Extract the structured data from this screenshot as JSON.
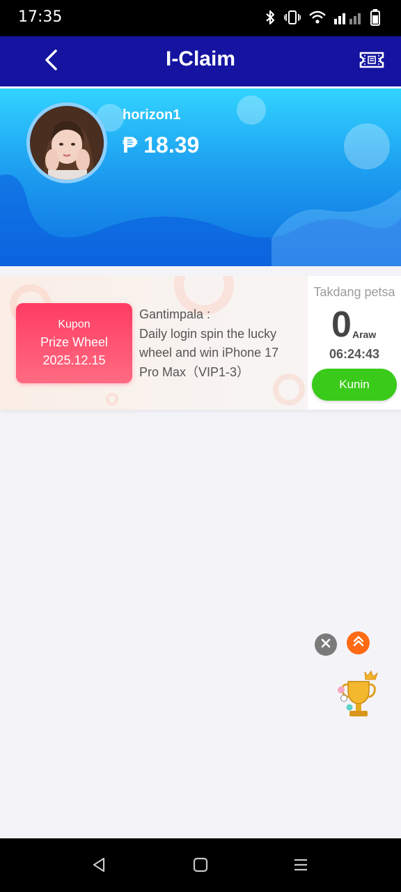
{
  "status_bar": {
    "time": "17:35",
    "icons": [
      "bluetooth-icon",
      "vibrate-icon",
      "wifi-icon",
      "signal-icon",
      "battery-icon"
    ]
  },
  "header": {
    "title": "I-Claim",
    "back_icon": "chevron-left-icon",
    "action_icon": "ticket-icon",
    "background_color": "#1414a0"
  },
  "profile": {
    "username": "horizon1",
    "balance": "₱ 18.39"
  },
  "coupon_card": {
    "coupon": {
      "kind": "Kupon",
      "name": "Prize Wheel",
      "date": "2025.12.15"
    },
    "prize_label": "Gantimpala :",
    "prize_description": "Daily login spin the lucky wheel and win iPhone 17 Pro Max（VIP1-3）",
    "deadline": {
      "label": "Takdang petsa",
      "days": "0",
      "days_unit": "Araw",
      "countdown": "06:24:43"
    },
    "claim_button": "Kunin",
    "claim_color": "#3acb1a",
    "coupon_color": "#ff3c62"
  },
  "floating": {
    "close_icon": "close-icon",
    "scroll_top_icon": "double-chevron-up-icon",
    "trophy_icon": "trophy-icon"
  },
  "nav_bar": {
    "icons": [
      "back-triangle-icon",
      "home-square-icon",
      "menu-lines-icon"
    ]
  }
}
